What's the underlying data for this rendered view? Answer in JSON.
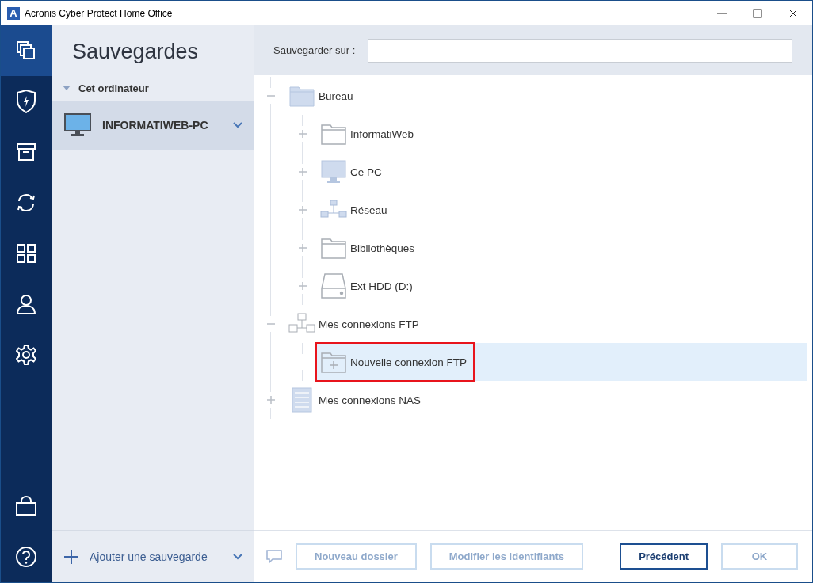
{
  "window": {
    "logo_letter": "A",
    "title": "Acronis Cyber Protect Home Office"
  },
  "nav": [
    {
      "kind": "backups",
      "selected": true
    },
    {
      "kind": "protection",
      "selected": false
    },
    {
      "kind": "archive",
      "selected": false
    },
    {
      "kind": "sync",
      "selected": false
    },
    {
      "kind": "tools",
      "selected": false
    },
    {
      "kind": "account",
      "selected": false
    },
    {
      "kind": "settings",
      "selected": false
    }
  ],
  "nav_bottom": [
    {
      "kind": "store"
    },
    {
      "kind": "help"
    }
  ],
  "sidebar": {
    "title": "Sauvegardes",
    "group": {
      "label": "Cet ordinateur",
      "expanded": true,
      "items": [
        {
          "label": "INFORMATIWEB-PC",
          "selected": true
        }
      ]
    },
    "add_button": "Ajouter une sauvegarde"
  },
  "destination": {
    "label": "Sauvegarder sur :"
  },
  "tree": [
    {
      "label": "Bureau",
      "kind": "folder-filled",
      "expanded": true,
      "selected": false,
      "highlighted": false,
      "children": [
        {
          "label": "InformatiWeb",
          "kind": "folder",
          "expanded": false,
          "selected": false,
          "highlighted": false
        },
        {
          "label": "Ce PC",
          "kind": "computer",
          "expanded": false,
          "selected": false,
          "highlighted": false
        },
        {
          "label": "Réseau",
          "kind": "network",
          "expanded": false,
          "selected": false,
          "highlighted": false
        },
        {
          "label": "Bibliothèques",
          "kind": "folder",
          "expanded": false,
          "selected": false,
          "highlighted": false
        },
        {
          "label": "Ext HDD (D:)",
          "kind": "drive",
          "expanded": false,
          "selected": false,
          "highlighted": false
        }
      ]
    },
    {
      "label": "Mes connexions FTP",
      "kind": "ftp",
      "expanded": true,
      "selected": false,
      "highlighted": false,
      "children": [
        {
          "label": "Nouvelle connexion FTP",
          "kind": "new-folder",
          "selected": true,
          "highlighted": true
        }
      ]
    },
    {
      "label": "Mes connexions NAS",
      "kind": "nas",
      "expanded": false,
      "selected": false,
      "highlighted": false
    }
  ],
  "buttons": [
    {
      "label": "Nouveau dossier",
      "disabled": true
    },
    {
      "label": "Modifier les identifiants",
      "disabled": true
    },
    {
      "label": "Précédent",
      "disabled": false
    },
    {
      "label": "OK",
      "disabled": true
    }
  ]
}
